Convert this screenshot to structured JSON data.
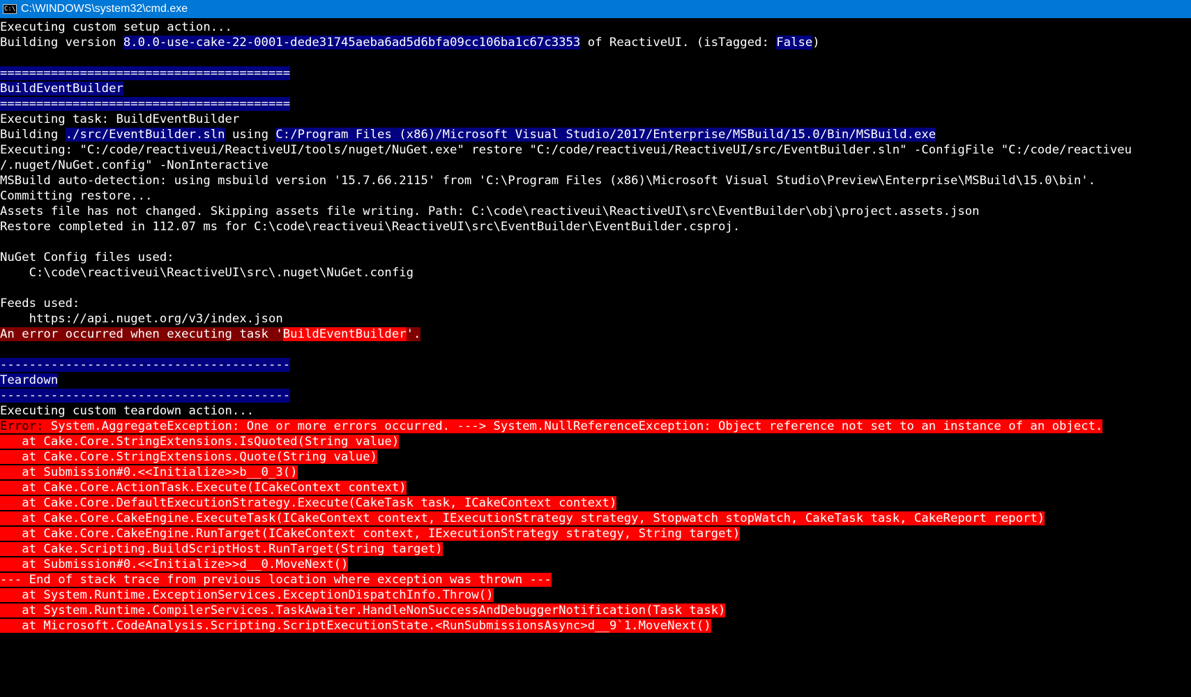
{
  "window": {
    "title": "C:\\WINDOWS\\system32\\cmd.exe",
    "icon": "cmd-icon",
    "icon_text": "C:\\."
  },
  "console": {
    "setup_line": "Executing custom setup action...",
    "build_version": {
      "prefix": "Building version ",
      "version": "8.0.0-use-cake-22-0001-dede31745aeba6ad5d6bfa09cc106ba1c67c3353",
      "middle": " of ReactiveUI. (isTagged: ",
      "tagged": "False",
      "suffix": ")"
    },
    "separator_equals": "========================================",
    "section1_title": "BuildEventBuilder",
    "executing_task": "Executing task: BuildEventBuilder",
    "building_line": {
      "prefix": "Building ",
      "solution": "./src/EventBuilder.sln",
      "middle": " using ",
      "msbuild": "C:/Program Files (x86)/Microsoft Visual Studio/2017/Enterprise/MSBuild/15.0/Bin/MSBuild.exe"
    },
    "executing_nuget": "Executing: \"C:/code/reactiveui/ReactiveUI/tools/nuget/NuGet.exe\" restore \"C:/code/reactiveui/ReactiveUI/src/EventBuilder.sln\" -ConfigFile \"C:/code/reactiveu",
    "executing_nuget_cont": "/.nuget/NuGet.config\" -NonInteractive",
    "msbuild_detect": "MSBuild auto-detection: using msbuild version '15.7.66.2115' from 'C:\\Program Files (x86)\\Microsoft Visual Studio\\Preview\\Enterprise\\MSBuild\\15.0\\bin'.",
    "committing": "Committing restore...",
    "assets": "Assets file has not changed. Skipping assets file writing. Path: C:\\code\\reactiveui\\ReactiveUI\\src\\EventBuilder\\obj\\project.assets.json",
    "restore_done": "Restore completed in 112.07 ms for C:\\code\\reactiveui\\ReactiveUI\\src\\EventBuilder\\EventBuilder.csproj.",
    "nuget_config_header": "NuGet Config files used:",
    "nuget_config_path": "    C:\\code\\reactiveui\\ReactiveUI\\src\\.nuget\\NuGet.config",
    "feeds_header": "Feeds used:",
    "feeds_url": "    https://api.nuget.org/v3/index.json",
    "task_error": {
      "prefix": "An error occurred when executing task '",
      "task": "BuildEventBuilder",
      "suffix": "'."
    },
    "separator_dashes": "----------------------------------------",
    "section2_title": "Teardown",
    "teardown_line": "Executing custom teardown action...",
    "error_line": {
      "label": "Error: ",
      "message": "System.AggregateException: One or more errors occurred. ---> System.NullReferenceException: Object reference not set to an instance of an object."
    },
    "stack_trace_1": [
      "   at Cake.Core.StringExtensions.IsQuoted(String value)",
      "   at Cake.Core.StringExtensions.Quote(String value)",
      "   at Submission#0.<<Initialize>>b__0_3()",
      "   at Cake.Core.ActionTask.Execute(ICakeContext context)",
      "   at Cake.Core.DefaultExecutionStrategy.Execute(CakeTask task, ICakeContext context)",
      "   at Cake.Core.CakeEngine.ExecuteTask(ICakeContext context, IExecutionStrategy strategy, Stopwatch stopWatch, CakeTask task, CakeReport report)",
      "   at Cake.Core.CakeEngine.RunTarget(ICakeContext context, IExecutionStrategy strategy, String target)",
      "   at Cake.Scripting.BuildScriptHost.RunTarget(String target)",
      "   at Submission#0.<<Initialize>>d__0.MoveNext()"
    ],
    "end_of_trace": "--- End of stack trace from previous location where exception was thrown ---",
    "stack_trace_2": [
      "   at System.Runtime.ExceptionServices.ExceptionDispatchInfo.Throw()",
      "   at System.Runtime.CompilerServices.TaskAwaiter.HandleNonSuccessAndDebuggerNotification(Task task)",
      "   at Microsoft.CodeAnalysis.Scripting.ScriptExecutionState.<RunSubmissionsAsync>d__9`1.MoveNext()"
    ]
  },
  "colors": {
    "titlebar": "#0078d7",
    "background": "#000000",
    "highlight_blue": "#000080",
    "error_red": "#ff0000",
    "dark_red": "#800000"
  }
}
